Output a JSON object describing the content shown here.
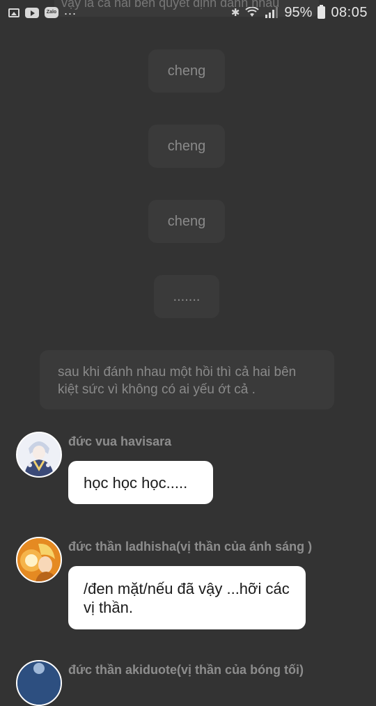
{
  "status_bar": {
    "left_icons": [
      "image-icon",
      "youtube-icon",
      "zalo-icon"
    ],
    "zalo_label": "Zalo",
    "more": "...",
    "bluetooth": "✱",
    "battery_percent": "95%",
    "time": "08:05"
  },
  "chat": {
    "top_cut_text": "vậy là cả hai bên quyết định đánh nhau",
    "narration": [
      "cheng",
      "cheng",
      "cheng",
      "......."
    ],
    "narration_long": "sau khi đánh nhau một hồi thì cả hai bên kiệt sức vì không có ai yếu ớt cả .",
    "messages": [
      {
        "sender": "đức vua havisara",
        "text": "học học học....."
      },
      {
        "sender": "đức thần ladhisha(vị thần của ánh sáng )",
        "text": "/đen mặt/nếu đã vậy ...hỡi các vị thần."
      },
      {
        "sender": "đức thần akiduote(vị thần của bóng tối)"
      }
    ]
  }
}
